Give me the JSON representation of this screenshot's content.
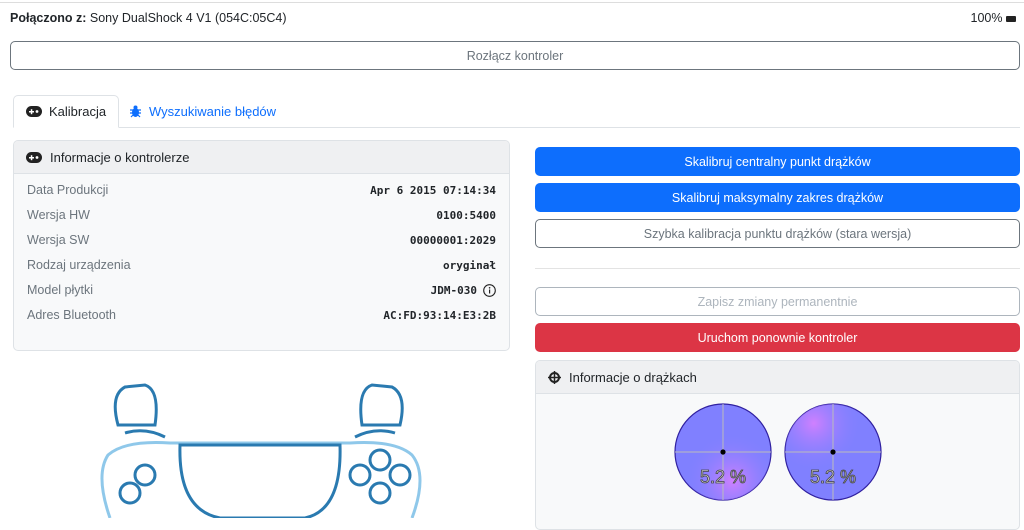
{
  "status": {
    "connected_label": "Połączono z:",
    "device": "Sony DualShock 4 V1 (054C:05C4)",
    "battery": "100%"
  },
  "disconnect_button": "Rozłącz kontroler",
  "tabs": [
    {
      "label": "Kalibracja",
      "icon": "gamepad-icon"
    },
    {
      "label": "Wyszukiwanie błędów",
      "icon": "bug-icon"
    }
  ],
  "controller_info": {
    "title": "Informacje o kontrolerze",
    "rows": [
      {
        "label": "Data Produkcji",
        "value": "Apr 6 2015 07:14:34"
      },
      {
        "label": "Wersja HW",
        "value": "0100:5400"
      },
      {
        "label": "Wersja SW",
        "value": "00000001:2029"
      },
      {
        "label": "Rodzaj urządzenia",
        "value": "oryginał"
      },
      {
        "label": "Model płytki",
        "value": "JDM-030"
      },
      {
        "label": "Adres Bluetooth",
        "value": "AC:FD:93:14:E3:2B"
      }
    ]
  },
  "actions": {
    "calibrate_center": "Skalibruj centralny punkt drążków",
    "calibrate_range": "Skalibruj maksymalny zakres drążków",
    "quick_calibrate": "Szybka kalibracja punktu drążków (stara wersja)",
    "save_permanent": "Zapisz zmiany permanentnie",
    "restart": "Uruchom ponownie kontroler"
  },
  "sticks": {
    "title": "Informacje o drążkach",
    "left": {
      "circularity_error": "5.2 %"
    },
    "right": {
      "circularity_error": "5.2 %"
    }
  },
  "colors": {
    "primary": "#0d6efd",
    "danger": "#dc3545",
    "stick_fill": "#8080ff",
    "stick_error": "#d080ff"
  }
}
